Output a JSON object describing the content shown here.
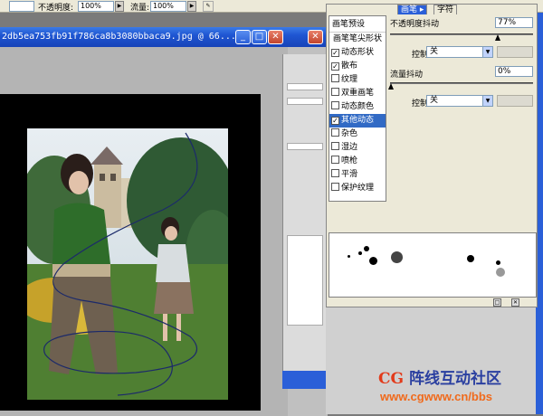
{
  "options_bar": {
    "first_value": "",
    "opacity_label": "不透明度:",
    "opacity_value": "100%",
    "flow_label": "流量:",
    "flow_value": "100%"
  },
  "document": {
    "title": "2db5ea753fb91f786ca8b3080bbaca9.jpg @ 66...",
    "minimize": "_",
    "maximize": "□",
    "close": "✕"
  },
  "panel": {
    "tabs": [
      {
        "label": "画笔 ▸",
        "active": true
      },
      {
        "label": "字符",
        "active": false
      }
    ],
    "brush_presets": "画笔预设",
    "list": [
      {
        "label": "画笔笔尖形状",
        "checkbox": false,
        "checked": false,
        "selected": false
      },
      {
        "label": "动态形状",
        "checkbox": true,
        "checked": true,
        "selected": false
      },
      {
        "label": "散布",
        "checkbox": true,
        "checked": true,
        "selected": false
      },
      {
        "label": "纹理",
        "checkbox": true,
        "checked": false,
        "selected": false
      },
      {
        "label": "双重画笔",
        "checkbox": true,
        "checked": false,
        "selected": false
      },
      {
        "label": "动态颜色",
        "checkbox": true,
        "checked": false,
        "selected": false
      },
      {
        "label": "其他动态",
        "checkbox": true,
        "checked": true,
        "selected": true
      },
      {
        "label": "杂色",
        "checkbox": true,
        "checked": false,
        "selected": false
      },
      {
        "label": "湿边",
        "checkbox": true,
        "checked": false,
        "selected": false
      },
      {
        "label": "喷枪",
        "checkbox": true,
        "checked": false,
        "selected": false
      },
      {
        "label": "平滑",
        "checkbox": true,
        "checked": false,
        "selected": false
      },
      {
        "label": "保护纹理",
        "checkbox": true,
        "checked": false,
        "selected": false
      }
    ],
    "opacity_jitter_label": "不透明度抖动",
    "opacity_jitter_value": "77%",
    "control_label_1": "控制:",
    "control_value_1": "关",
    "flow_jitter_label": "流量抖动",
    "flow_jitter_value": "0%",
    "control_label_2": "控制:",
    "control_value_2": "关"
  },
  "watermark": {
    "cg": "CG",
    "name": "阵线互动社区",
    "url": "www.cgwww.cn/bbs"
  },
  "colors": {
    "title_bar": "#1f56d2",
    "selected_item": "#316ac5",
    "panel_bg": "#ece9d8"
  }
}
